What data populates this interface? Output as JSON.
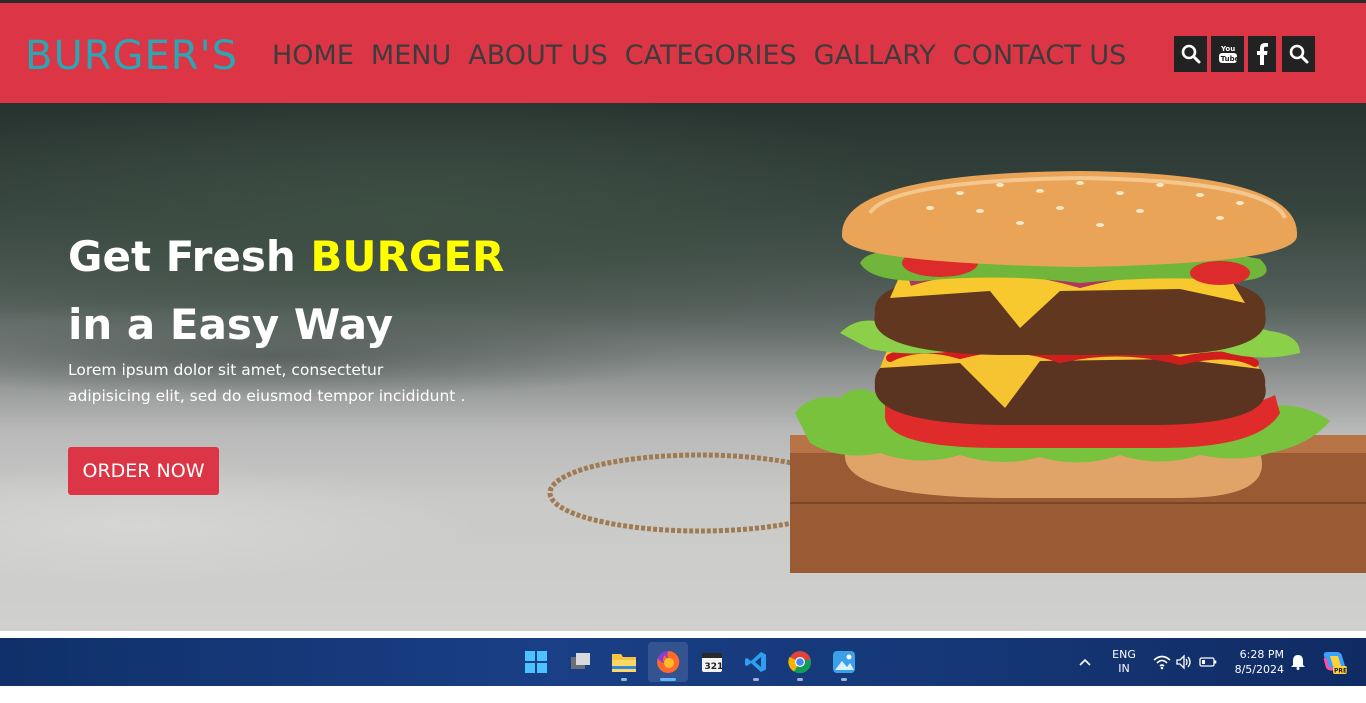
{
  "brand": {
    "name": "BURGER'S"
  },
  "nav": {
    "items": [
      "HOME",
      "MENU",
      "ABOUT US",
      "CATEGORIES",
      "GALLARY",
      "CONTACT US"
    ]
  },
  "social": {
    "buttons": [
      "search-icon",
      "youtube-icon",
      "facebook-icon",
      "search-icon"
    ]
  },
  "hero": {
    "title_prefix": "Get Fresh ",
    "title_highlight": "BURGER",
    "title_line2": "in a Easy Way",
    "subtitle": "Lorem ipsum dolor sit amet, consectetur adipisicing elit, sed do eiusmod tempor incididunt .",
    "button": "ORDER NOW"
  },
  "colors": {
    "navbar": "#dc3545",
    "brand": "#2aa6b5",
    "highlight": "#ffff00",
    "button": "#dc3545"
  },
  "taskbar": {
    "apps": [
      "windows-start-icon",
      "task-view-icon",
      "file-explorer-icon",
      "firefox-icon",
      "clipchamp-icon",
      "vscode-icon",
      "chrome-icon",
      "photos-icon"
    ],
    "lang_line1": "ENG",
    "lang_line2": "IN",
    "time": "6:28 PM",
    "date": "8/5/2024"
  }
}
